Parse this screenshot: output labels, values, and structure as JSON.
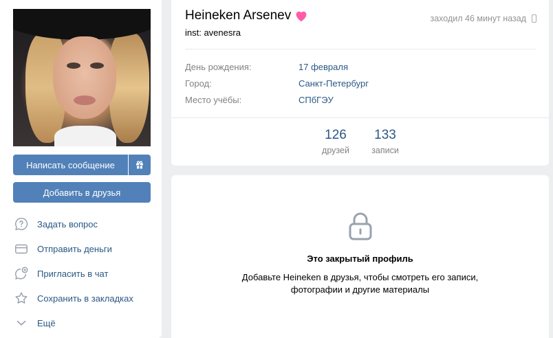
{
  "profile": {
    "name": "Heineken Arsenev",
    "status": "inst: avenesra",
    "last_seen": "заходил 46 минут назад",
    "info": [
      {
        "label": "День рождения:",
        "value": "17 февраля"
      },
      {
        "label": "Город:",
        "value": "Санкт-Петербург"
      },
      {
        "label": "Место учёбы:",
        "value": "СПбГЭУ"
      }
    ],
    "counters": [
      {
        "number": "126",
        "label": "друзей"
      },
      {
        "number": "133",
        "label": "записи"
      }
    ]
  },
  "actions": {
    "message_label": "Написать сообщение",
    "add_friend_label": "Добавить в друзья"
  },
  "menu": {
    "items": [
      {
        "label": "Задать вопрос",
        "icon": "question-bubble-icon"
      },
      {
        "label": "Отправить деньги",
        "icon": "card-icon"
      },
      {
        "label": "Пригласить в чат",
        "icon": "chat-add-icon"
      },
      {
        "label": "Сохранить в закладках",
        "icon": "star-icon"
      },
      {
        "label": "Ещё",
        "icon": "chevron-down-icon"
      }
    ]
  },
  "closed_profile": {
    "title": "Это закрытый профиль",
    "text": "Добавьте Heineken в друзья, чтобы смотреть его записи, фотографии и другие материалы"
  },
  "colors": {
    "accent": "#5181b8",
    "link": "#2a5885",
    "background": "#edeef0",
    "heart": "#ff5ca8"
  }
}
